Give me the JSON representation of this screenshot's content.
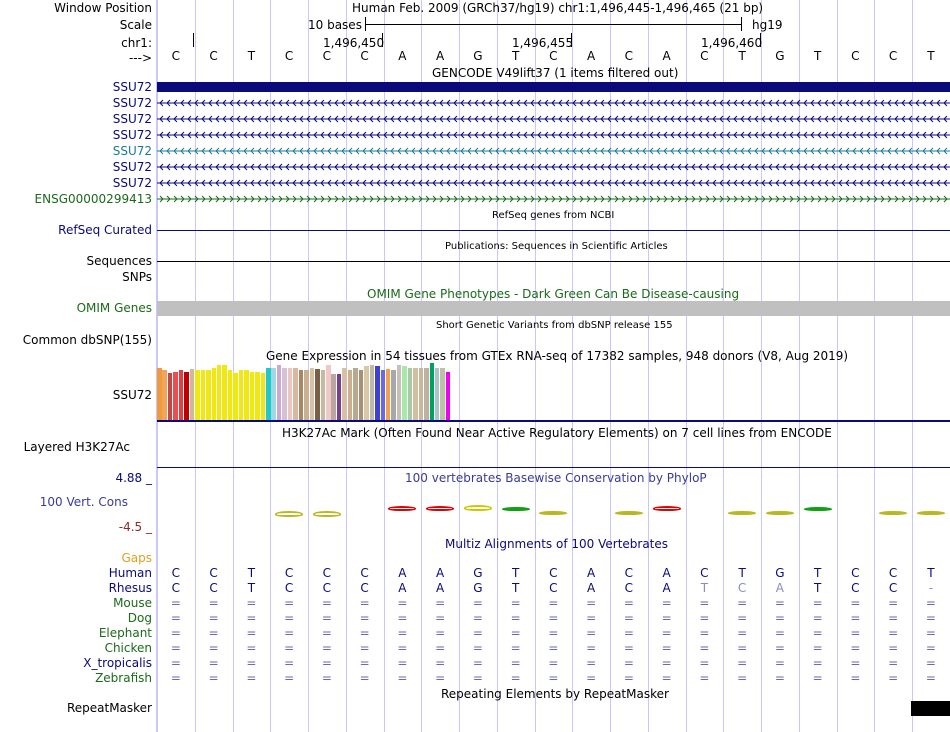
{
  "header": {
    "window_position_label": "Window Position",
    "window_position_value": "Human Feb. 2009 (GRCh37/hg19)   chr1:1,496,445-1,496,465 (21 bp)",
    "scale_label": "Scale",
    "scale_value": "10 bases",
    "scale_assembly": "hg19",
    "chr_label": "chr1:",
    "strand_label": "--->",
    "ruler_ticks": [
      "1,496,450",
      "1,496,455",
      "1,496,460"
    ]
  },
  "sequence": [
    "C",
    "C",
    "T",
    "C",
    "C",
    "C",
    "A",
    "A",
    "G",
    "T",
    "C",
    "A",
    "C",
    "A",
    "C",
    "T",
    "G",
    "T",
    "C",
    "C",
    "T"
  ],
  "gencode": {
    "title": "GENCODE V49lift37 (1 items filtered out)",
    "rows": [
      {
        "label": "SSU72",
        "style": "solid",
        "color": "#0a0a7a"
      },
      {
        "label": "SSU72",
        "style": "arrows-left",
        "color": "#0a0a7a"
      },
      {
        "label": "SSU72",
        "style": "arrows-left",
        "color": "#0a0a7a"
      },
      {
        "label": "SSU72",
        "style": "arrows-left",
        "color": "#0a0a7a"
      },
      {
        "label": "SSU72",
        "style": "arrows-left",
        "color": "#1a7a9a"
      },
      {
        "label": "SSU72",
        "style": "arrows-left",
        "color": "#0a0a7a"
      },
      {
        "label": "SSU72",
        "style": "arrows-left",
        "color": "#0a0a7a"
      },
      {
        "label": "ENSG00000299413",
        "style": "arrows-right",
        "color": "#1a6a1a"
      }
    ]
  },
  "refseq": {
    "title": "RefSeq genes from NCBI",
    "label": "RefSeq Curated"
  },
  "publications": {
    "title": "Publications: Sequences in Scientific Articles",
    "label1": "Sequences",
    "label2": "SNPs"
  },
  "omim": {
    "title": "OMIM Gene Phenotypes - Dark Green Can Be Disease-causing",
    "label": "OMIM Genes"
  },
  "dbsnp": {
    "title": "Short Genetic Variants from dbSNP release 155",
    "label": "Common dbSNP(155)"
  },
  "gtex": {
    "title": "Gene Expression in 54 tissues from GTEx RNA-seq of 17382 samples, 948 donors (V8, Aug 2019)",
    "label": "SSU72",
    "bars": [
      {
        "color": "#f09a3e",
        "value": 0.92
      },
      {
        "color": "#f2a55a",
        "value": 0.88
      },
      {
        "color": "#c04848",
        "value": 0.83
      },
      {
        "color": "#e85050",
        "value": 0.85
      },
      {
        "color": "#e04040",
        "value": 0.88
      },
      {
        "color": "#c00000",
        "value": 0.85
      },
      {
        "color": "#cfb8a0",
        "value": 0.9
      },
      {
        "color": "#f0e810",
        "value": 0.87
      },
      {
        "color": "#f0e810",
        "value": 0.87
      },
      {
        "color": "#f0e810",
        "value": 0.88
      },
      {
        "color": "#f0e810",
        "value": 0.92
      },
      {
        "color": "#f0e810",
        "value": 0.96
      },
      {
        "color": "#f0e810",
        "value": 0.96
      },
      {
        "color": "#f0e810",
        "value": 0.88
      },
      {
        "color": "#f0e810",
        "value": 0.83
      },
      {
        "color": "#f0e810",
        "value": 0.88
      },
      {
        "color": "#f0e810",
        "value": 0.88
      },
      {
        "color": "#f0e810",
        "value": 0.85
      },
      {
        "color": "#f0e810",
        "value": 0.85
      },
      {
        "color": "#f0e810",
        "value": 0.83
      },
      {
        "color": "#20c8c8",
        "value": 0.92
      },
      {
        "color": "#a0d8e8",
        "value": 0.92
      },
      {
        "color": "#c8a8d8",
        "value": 0.96
      },
      {
        "color": "#d8c0d0",
        "value": 0.92
      },
      {
        "color": "#e8c8c0",
        "value": 0.92
      },
      {
        "color": "#d8b8a0",
        "value": 0.92
      },
      {
        "color": "#a88860",
        "value": 0.88
      },
      {
        "color": "#c8b090",
        "value": 0.88
      },
      {
        "color": "#d8c0a8",
        "value": 0.92
      },
      {
        "color": "#786048",
        "value": 0.9
      },
      {
        "color": "#c8b8a0",
        "value": 0.88
      },
      {
        "color": "#f0c8c8",
        "value": 0.96
      },
      {
        "color": "#b8a8a0",
        "value": 0.8
      },
      {
        "color": "#7a3e8a",
        "value": 0.8
      },
      {
        "color": "#d8c0a8",
        "value": 0.92
      },
      {
        "color": "#c8b090",
        "value": 0.88
      },
      {
        "color": "#b8a890",
        "value": 0.92
      },
      {
        "color": "#a89070",
        "value": 0.88
      },
      {
        "color": "#d8c8a8",
        "value": 0.94
      },
      {
        "color": "#c0b8a8",
        "value": 0.96
      },
      {
        "color": "#4040d0",
        "value": 0.94
      },
      {
        "color": "#6868e8",
        "value": 0.88
      },
      {
        "color": "#f0a050",
        "value": 0.9
      },
      {
        "color": "#a8a8a8",
        "value": 0.88
      },
      {
        "color": "#c8c0b8",
        "value": 0.96
      },
      {
        "color": "#a8e8a8",
        "value": 0.94
      },
      {
        "color": "#a8c8a8",
        "value": 0.92
      },
      {
        "color": "#d0c0a0",
        "value": 0.92
      },
      {
        "color": "#c8b8a0",
        "value": 0.92
      },
      {
        "color": "#c0b0a0",
        "value": 0.92
      },
      {
        "color": "#00a060",
        "value": 1.0
      },
      {
        "color": "#a8c8c8",
        "value": 0.92
      },
      {
        "color": "#c0c0a8",
        "value": 0.92
      },
      {
        "color": "#f000f0",
        "value": 0.85
      }
    ]
  },
  "h3k27ac": {
    "title": "H3K27Ac Mark (Often Found Near Active Regulatory Elements) on 7 cell lines from ENCODE",
    "label": "Layered H3K27Ac"
  },
  "phylop": {
    "title": "100 vertebrates Basewise Conservation by PhyloP",
    "label": "100 Vert. Cons",
    "ymax": "4.88 _",
    "ymin": "-4.5 _",
    "cons": [
      0,
      0,
      0,
      -0.6,
      -0.6,
      0,
      0.5,
      0.5,
      0.6,
      0.4,
      -0.3,
      0,
      -0.3,
      0.5,
      0,
      -0.3,
      -0.3,
      0.3,
      0,
      -0.3,
      -0.3
    ]
  },
  "multiz": {
    "title": "Multiz Alignments of 100 Vertebrates",
    "gaps_label": "Gaps",
    "species": [
      {
        "name": "Human",
        "color": "#0a0a7a",
        "seq": [
          "C",
          "C",
          "T",
          "C",
          "C",
          "C",
          "A",
          "A",
          "G",
          "T",
          "C",
          "A",
          "C",
          "A",
          "C",
          "T",
          "G",
          "T",
          "C",
          "C",
          "T"
        ]
      },
      {
        "name": "Rhesus",
        "color": "#0a0a7a",
        "seq": [
          "C",
          "C",
          "T",
          "C",
          "C",
          "C",
          "A",
          "A",
          "G",
          "T",
          "C",
          "A",
          "C",
          "A",
          "T",
          "C",
          "A",
          "T",
          "C",
          "C",
          "-"
        ]
      },
      {
        "name": "Mouse",
        "color": "#1a6a1a",
        "seq": [
          "=",
          "=",
          "=",
          "=",
          "=",
          "=",
          "=",
          "=",
          "=",
          "=",
          "=",
          "=",
          "=",
          "=",
          "=",
          "=",
          "=",
          "=",
          "=",
          "=",
          "="
        ]
      },
      {
        "name": "Dog",
        "color": "#1a6a1a",
        "seq": [
          "=",
          "=",
          "=",
          "=",
          "=",
          "=",
          "=",
          "=",
          "=",
          "=",
          "=",
          "=",
          "=",
          "=",
          "=",
          "=",
          "=",
          "=",
          "=",
          "=",
          "="
        ]
      },
      {
        "name": "Elephant",
        "color": "#1a6a1a",
        "seq": [
          "=",
          "=",
          "=",
          "=",
          "=",
          "=",
          "=",
          "=",
          "=",
          "=",
          "=",
          "=",
          "=",
          "=",
          "=",
          "=",
          "=",
          "=",
          "=",
          "=",
          "="
        ]
      },
      {
        "name": "Chicken",
        "color": "#1a6a1a",
        "seq": [
          "=",
          "=",
          "=",
          "=",
          "=",
          "=",
          "=",
          "=",
          "=",
          "=",
          "=",
          "=",
          "=",
          "=",
          "=",
          "=",
          "=",
          "=",
          "=",
          "=",
          "="
        ]
      },
      {
        "name": "X_tropicalis",
        "color": "#0a0a7a",
        "seq": [
          "=",
          "=",
          "=",
          "=",
          "=",
          "=",
          "=",
          "=",
          "=",
          "=",
          "=",
          "=",
          "=",
          "=",
          "=",
          "=",
          "=",
          "=",
          "=",
          "=",
          "="
        ]
      },
      {
        "name": "Zebrafish",
        "color": "#1a6a1a",
        "seq": [
          "=",
          "=",
          "=",
          "=",
          "=",
          "=",
          "=",
          "=",
          "=",
          "=",
          "=",
          "=",
          "=",
          "=",
          "=",
          "=",
          "=",
          "=",
          "=",
          "=",
          "="
        ]
      }
    ]
  },
  "repeatmasker": {
    "title": "Repeating Elements by RepeatMasker",
    "label": "RepeatMasker"
  }
}
